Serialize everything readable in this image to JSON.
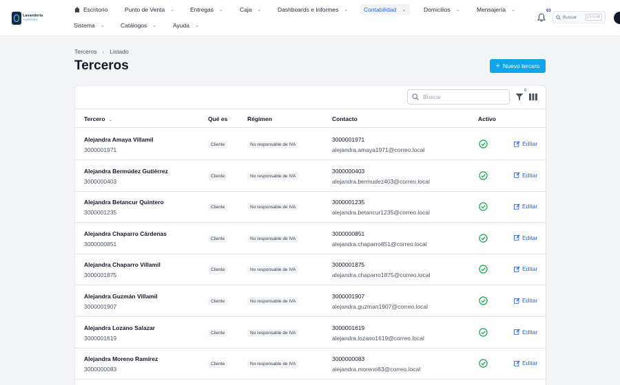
{
  "brand": {
    "name_line1": "Lavandería",
    "name_line2": "AURORA"
  },
  "nav": {
    "row1": [
      {
        "label": "Escritorio",
        "name": "nav-escritorio"
      },
      {
        "label": "Punto de Venta",
        "name": "nav-punto-de-venta"
      },
      {
        "label": "Entregas",
        "name": "nav-entregas"
      },
      {
        "label": "Caja",
        "name": "nav-caja"
      },
      {
        "label": "Dashboards e Informes",
        "name": "nav-dashboards"
      },
      {
        "label": "Contabilidad",
        "name": "nav-contabilidad"
      },
      {
        "label": "Domicilios",
        "name": "nav-domicilios"
      },
      {
        "label": "Mensajería",
        "name": "nav-mensajeria"
      }
    ],
    "row2": [
      {
        "label": "Sistema"
      },
      {
        "label": "Catálogos"
      },
      {
        "label": "Ayuda"
      }
    ]
  },
  "header": {
    "notification_count": "63",
    "search_label": "Buscar",
    "search_shortcut": "Ctrl+K"
  },
  "breadcrumb": {
    "parent": "Terceros",
    "current": "Listado"
  },
  "page": {
    "title": "Terceros",
    "new_button": "Nuevo tercero"
  },
  "table": {
    "search_placeholder": "Buscar",
    "filter_count": "0",
    "columns": {
      "tercero": "Tercero",
      "que_es": "Qué es",
      "regimen": "Régimen",
      "contacto": "Contacto",
      "activo": "Activo"
    },
    "edit_label": "Editar",
    "rows": [
      {
        "name": "Alejandra Amaya Villamil",
        "id": "3000001971",
        "type": "Cliente",
        "regime": "No responsable de IVA",
        "phone": "3000001971",
        "email": "alejandra.amaya1971@correo.local",
        "active": true
      },
      {
        "name": "Alejandra Bermúdez Gutiérrez",
        "id": "3000000403",
        "type": "Cliente",
        "regime": "No responsable de IVA",
        "phone": "3000000403",
        "email": "alejandra.bermudez403@correo.local",
        "active": true
      },
      {
        "name": "Alejandra Betancur Quintero",
        "id": "3000001235",
        "type": "Cliente",
        "regime": "No responsable de IVA",
        "phone": "3000001235",
        "email": "alejandra.betancur1235@correo.local",
        "active": true
      },
      {
        "name": "Alejandra Chaparro Cárdenas",
        "id": "3000000851",
        "type": "Cliente",
        "regime": "No responsable de IVA",
        "phone": "3000000851",
        "email": "alejandra.chaparro851@correo.local",
        "active": true
      },
      {
        "name": "Alejandra Chaparro Villamil",
        "id": "3000001875",
        "type": "Cliente",
        "regime": "No responsable de IVA",
        "phone": "3000001875",
        "email": "alejandra.chaparro1875@correo.local",
        "active": true
      },
      {
        "name": "Alejandra Guzmán Villamil",
        "id": "3000001907",
        "type": "Cliente",
        "regime": "No responsable de IVA",
        "phone": "3000001907",
        "email": "alejandra.guzman1907@correo.local",
        "active": true
      },
      {
        "name": "Alejandra Lozano Salazar",
        "id": "3000001619",
        "type": "Cliente",
        "regime": "No responsable de IVA",
        "phone": "3000001619",
        "email": "alejandra.lozano1619@correo.local",
        "active": true
      },
      {
        "name": "Alejandra Moreno Ramírez",
        "id": "3000000083",
        "type": "Cliente",
        "regime": "No responsable de IVA",
        "phone": "3000000083",
        "email": "alejandra.moreno83@correo.local",
        "active": true
      }
    ]
  },
  "colors": {
    "accent": "#0ea5e9",
    "link": "#2563eb",
    "active_green": "#16a34a",
    "brand_navy": "#0f2d4a"
  }
}
